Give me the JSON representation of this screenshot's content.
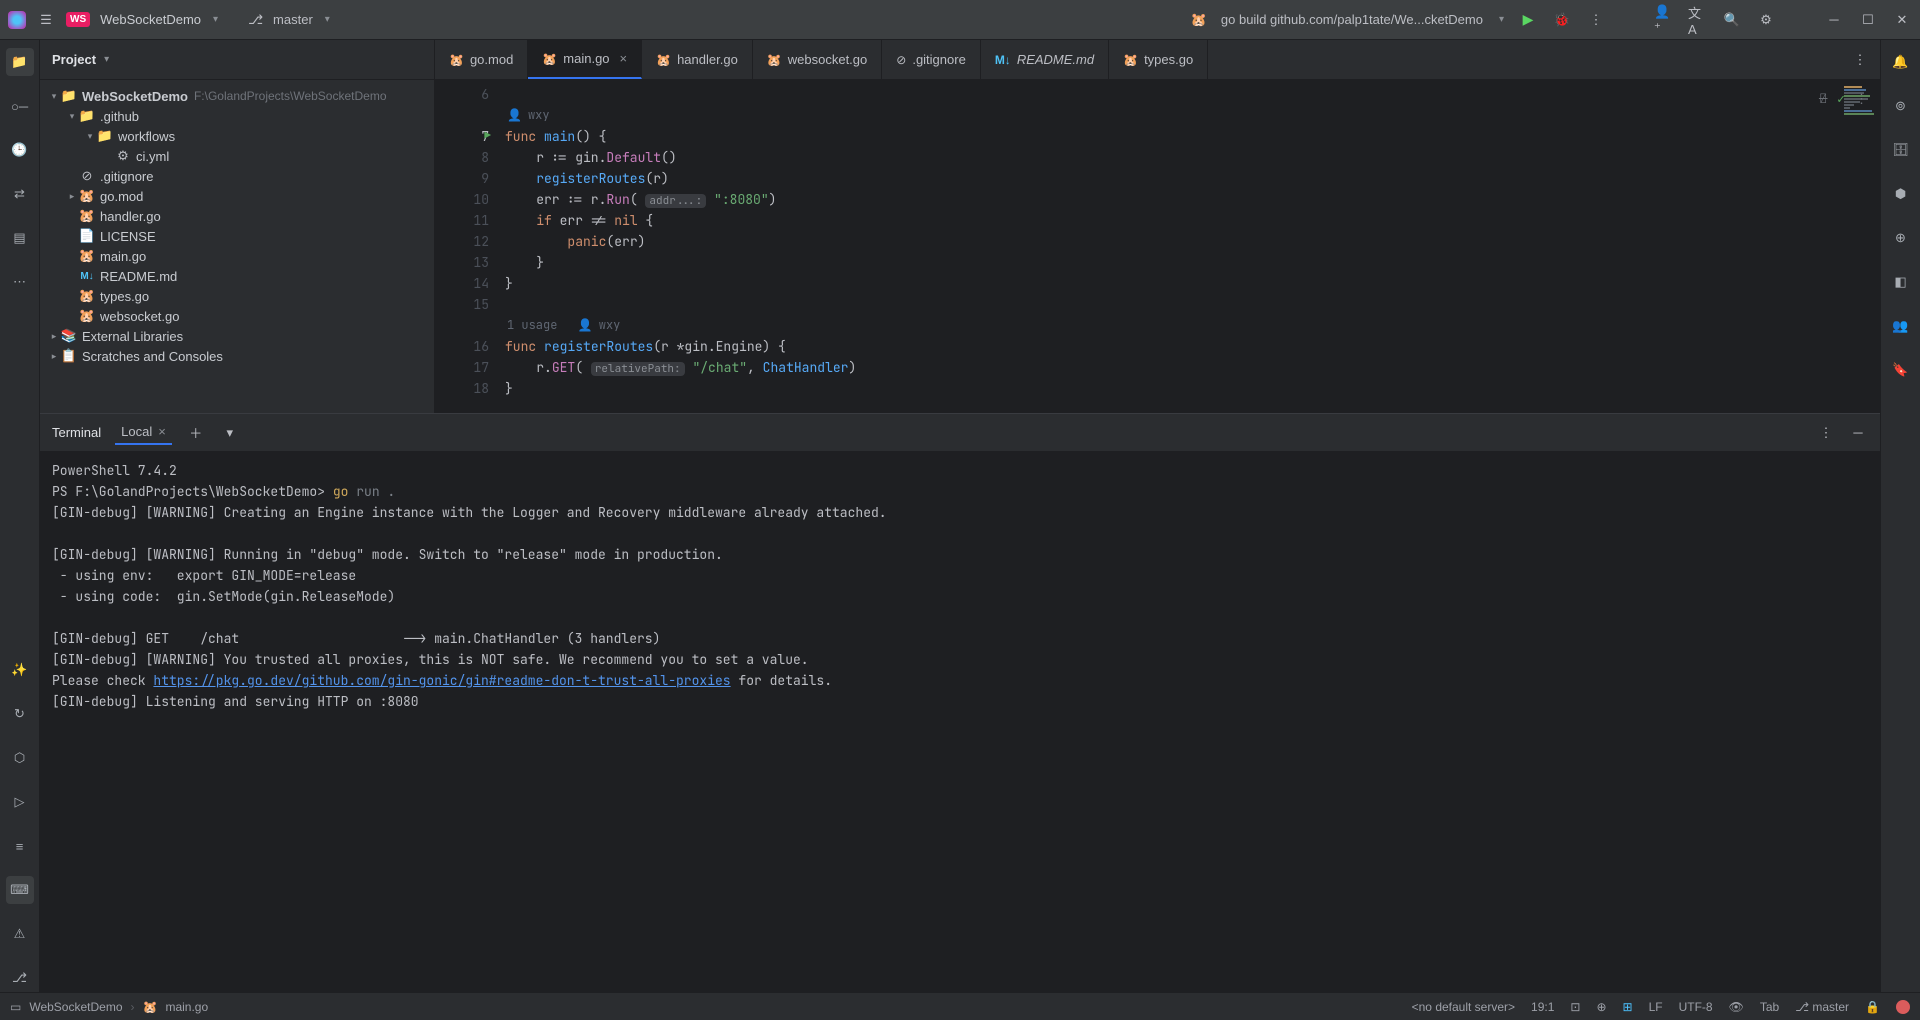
{
  "titlebar": {
    "project": "WebSocketDemo",
    "branch": "master",
    "runconfig": "go build github.com/palp1tate/We...cketDemo"
  },
  "project_panel": {
    "title": "Project",
    "root": "WebSocketDemo",
    "root_path": "F:\\GolandProjects\\WebSocketDemo",
    "github": ".github",
    "workflows": "workflows",
    "ci": "ci.yml",
    "gitignore": ".gitignore",
    "gomod": "go.mod",
    "handler": "handler.go",
    "license": "LICENSE",
    "maingo": "main.go",
    "readme": "README.md",
    "types": "types.go",
    "websocket": "websocket.go",
    "extlib": "External Libraries",
    "scratches": "Scratches and Consoles"
  },
  "tabs": [
    {
      "label": "go.mod"
    },
    {
      "label": "main.go",
      "active": true
    },
    {
      "label": "handler.go"
    },
    {
      "label": "websocket.go"
    },
    {
      "label": ".gitignore"
    },
    {
      "label": "README.md"
    },
    {
      "label": "types.go"
    }
  ],
  "editor": {
    "author": "wxy",
    "usage": "1 usage",
    "lines": {
      "l6": "6",
      "l7": "7",
      "l8": "8",
      "l9": "9",
      "l10": "10",
      "l11": "11",
      "l12": "12",
      "l13": "13",
      "l14": "14",
      "l15": "15",
      "l16": "16",
      "l17": "17",
      "l18": "18"
    },
    "hint_addr": "addr...:",
    "hint_path": "relativePath:",
    "str_port": "\":8080\"",
    "str_chat": "\"/chat\"",
    "chathandler": "ChatHandler"
  },
  "terminal": {
    "title": "Terminal",
    "tab": "Local",
    "line_ps": "PowerShell 7.4.2",
    "prompt": "PS F:\\GolandProjects\\WebSocketDemo> ",
    "cmd_go": "go ",
    "cmd_rest": "run .",
    "l1": "[GIN-debug] [WARNING] Creating an Engine instance with the Logger and Recovery middleware already attached.",
    "l2": "[GIN-debug] [WARNING] Running in \"debug\" mode. Switch to \"release\" mode in production.",
    "l3": " - using env:   export GIN_MODE=release",
    "l4": " - using code:  gin.SetMode(gin.ReleaseMode)",
    "l5": "[GIN-debug] GET    /chat                     --> main.ChatHandler (3 handlers)",
    "l6": "[GIN-debug] [WARNING] You trusted all proxies, this is NOT safe. We recommend you to set a value.",
    "l7a": "Please check ",
    "l7link": "https://pkg.go.dev/github.com/gin-gonic/gin#readme-don-t-trust-all-proxies",
    "l7b": " for details.",
    "l8": "[GIN-debug] Listening and serving HTTP on :8080"
  },
  "status": {
    "bc_project": "WebSocketDemo",
    "bc_file": "main.go",
    "server": "<no default server>",
    "pos": "19:1",
    "le": "LF",
    "enc": "UTF-8",
    "indent": "Tab",
    "branch": "master"
  }
}
